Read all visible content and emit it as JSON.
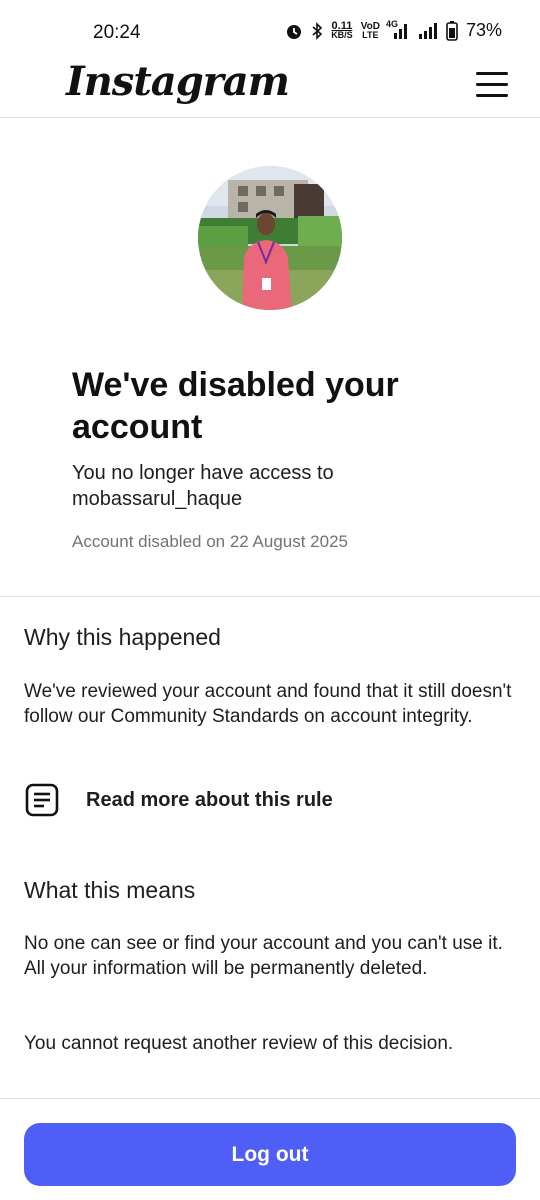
{
  "status_bar": {
    "time": "20:24",
    "net_speed_value": "0.11",
    "net_speed_unit": "KB/S",
    "volte_top": "VoD",
    "volte_bottom": "LTE",
    "network_type": "4G",
    "battery": "73%"
  },
  "header": {
    "logo_text": "Instagram",
    "menu_icon": "hamburger-menu-icon"
  },
  "profile": {
    "avatar_icon": "profile-photo"
  },
  "notice": {
    "headline": "We've disabled your account",
    "access_text": "You no longer have access to mobassarul_haque",
    "disabled_date": "Account disabled on 22 August 2025"
  },
  "why_section": {
    "title": "Why this happened",
    "body": "We've reviewed your account and found that it still doesn't follow our Community Standards on account integrity.",
    "rule_link_label": "Read more about this rule",
    "rule_link_icon": "document-icon"
  },
  "means_section": {
    "title": "What this means",
    "body": "No one can see or find your account and you can't use it. All your information will be permanently deleted.",
    "review_note": "You cannot request another review of this decision."
  },
  "actions": {
    "logout_label": "Log out"
  },
  "colors": {
    "primary_button": "#4f5ff6",
    "muted_text": "#737373",
    "divider": "#e2e4e8"
  }
}
